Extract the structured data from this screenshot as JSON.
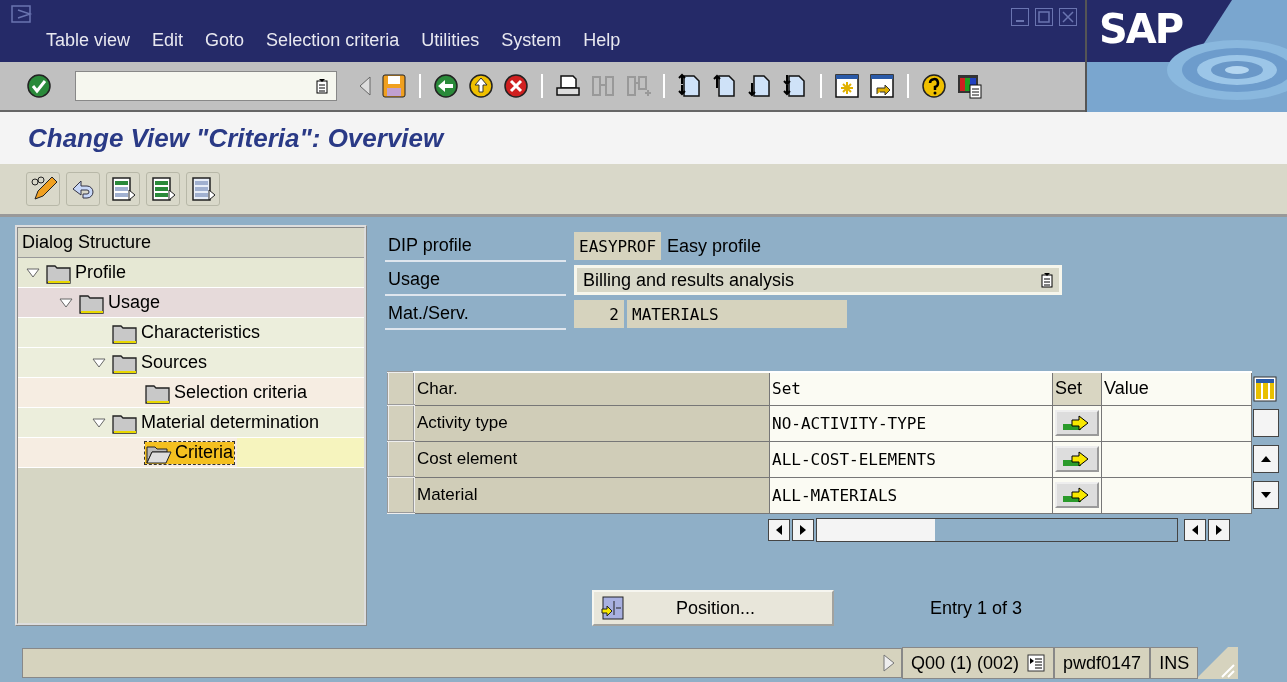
{
  "window": {
    "logo": "SAP"
  },
  "menu": [
    "Table view",
    "Edit",
    "Goto",
    "Selection criteria",
    "Utilities",
    "System",
    "Help"
  ],
  "title": "Change View \"Criteria\": Overview",
  "tree": {
    "header": "Dialog Structure",
    "items": [
      {
        "label": "Profile",
        "expanded": true,
        "selected": false,
        "children": [
          {
            "label": "Usage",
            "expanded": true,
            "selected": false,
            "children": [
              {
                "label": "Characteristics",
                "selected": false
              },
              {
                "label": "Sources",
                "expanded": true,
                "selected": false,
                "children": [
                  {
                    "label": "Selection criteria",
                    "selected": false
                  }
                ]
              },
              {
                "label": "Material determination",
                "expanded": true,
                "selected": false,
                "children": [
                  {
                    "label": "Criteria",
                    "selected": true
                  }
                ]
              }
            ]
          }
        ]
      }
    ]
  },
  "form": [
    {
      "kind": "key",
      "label": "DIP profile",
      "value": "EASYPROF",
      "text": "Easy profile"
    },
    {
      "kind": "dropdown",
      "label": "Usage",
      "value": "Billing and results analysis"
    },
    {
      "kind": "number",
      "label": "Mat./Serv.",
      "value": "2",
      "text": "MATERIALS"
    }
  ],
  "table": {
    "columns": [
      "Char.",
      "Set",
      "Set",
      "Value"
    ],
    "rows": [
      {
        "char": "Activity type",
        "set": "NO-ACTIVITY-TYPE"
      },
      {
        "char": "Cost element",
        "set": "ALL-COST-ELEMENTS"
      },
      {
        "char": "Material",
        "set": "ALL-MATERIALS"
      }
    ]
  },
  "position_button": "Position...",
  "entry": "Entry 1 of 3",
  "status_bar": {
    "system": "Q00 (1) (002)",
    "server": "pwdf0147",
    "mode": "INS"
  }
}
